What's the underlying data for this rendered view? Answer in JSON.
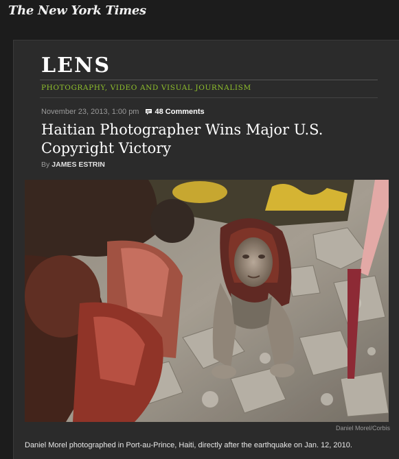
{
  "site": {
    "logo_text": "The New York Times"
  },
  "blog": {
    "title": "LENS",
    "tagline": "PHOTOGRAPHY, VIDEO AND VISUAL JOURNALISM",
    "accent_color": "#8fc02c"
  },
  "article": {
    "dateline": "November 23, 2013, 1:00 pm",
    "comments_label": "48 Comments",
    "comments_icon": "speech-bubble-icon",
    "headline": "Haitian Photographer Wins Major U.S. Copyright Victory",
    "byline_prefix": "By",
    "author": "JAMES ESTRIN"
  },
  "photo": {
    "credit": "Daniel Morel/Corbis",
    "caption": "Daniel Morel photographed in Port-au-Prince, Haiti, directly after the earthquake on Jan. 12, 2010."
  }
}
